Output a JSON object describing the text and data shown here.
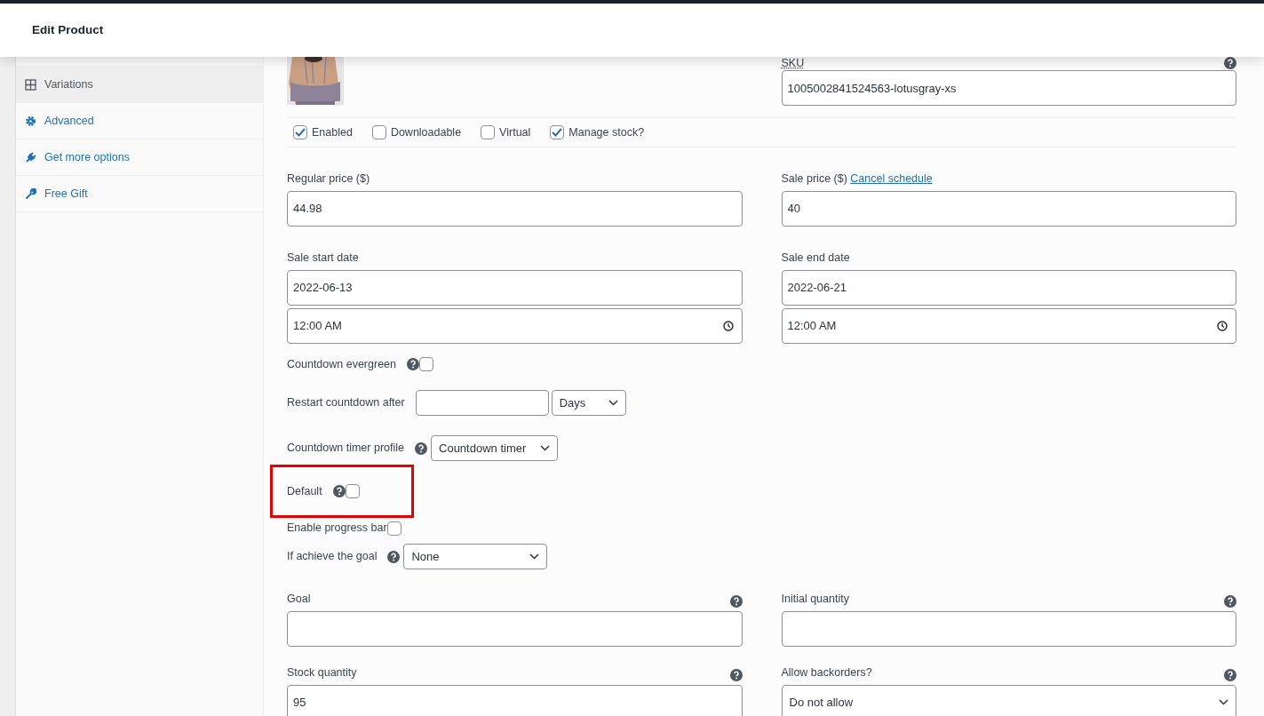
{
  "header": {
    "title": "Edit Product"
  },
  "sidebar": {
    "items": [
      {
        "label": "Variations",
        "selected": true
      },
      {
        "label": "Advanced",
        "selected": false
      },
      {
        "label": "Get more options",
        "selected": false
      },
      {
        "label": "Free Gift",
        "selected": false
      }
    ]
  },
  "sku": {
    "label": "SKU",
    "value": "1005002841524563-lotusgray-xs",
    "help": true
  },
  "options": [
    {
      "label": "Enabled",
      "checked": true
    },
    {
      "label": "Downloadable",
      "checked": false
    },
    {
      "label": "Virtual",
      "checked": false
    },
    {
      "label": "Manage stock?",
      "checked": true
    }
  ],
  "pricing": [
    {
      "label": "Regular price ($)",
      "value": "44.98"
    },
    {
      "label": "Sale price ($)",
      "link": "Cancel schedule",
      "value": "40"
    }
  ],
  "schedule": [
    {
      "label": "Sale start date",
      "date": "2022-06-13",
      "time": "12:00 AM"
    },
    {
      "label": "Sale end date",
      "date": "2022-06-21",
      "time": "12:00 AM"
    }
  ],
  "countdown": [
    {
      "kind": "checkbox",
      "label": "Countdown evergreen",
      "help": true,
      "checked": false,
      "highlighted": false
    },
    {
      "kind": "number_unit",
      "label": "Restart countdown after",
      "help": false,
      "unit": "Days",
      "highlighted": false
    },
    {
      "kind": "select",
      "label": "Countdown timer profile",
      "help": true,
      "value": "Countdown timer",
      "highlighted": false
    },
    {
      "kind": "checkbox",
      "label": "Default",
      "help": true,
      "checked": false,
      "highlighted": true
    },
    {
      "kind": "checkbox",
      "label": "Enable progress bar",
      "help": false,
      "checked": false,
      "highlighted": false
    },
    {
      "kind": "select",
      "label": "If achieve the goal",
      "help": true,
      "value": "None",
      "highlighted": false
    }
  ],
  "quantities": [
    {
      "kind": "text",
      "label": "Goal",
      "help": true
    },
    {
      "kind": "text",
      "label": "Initial quantity",
      "help": true
    },
    {
      "kind": "text",
      "label": "Stock quantity",
      "help": true,
      "value": "95"
    },
    {
      "kind": "select",
      "label": "Allow backorders?",
      "help": true,
      "value": "Do not allow"
    }
  ]
}
